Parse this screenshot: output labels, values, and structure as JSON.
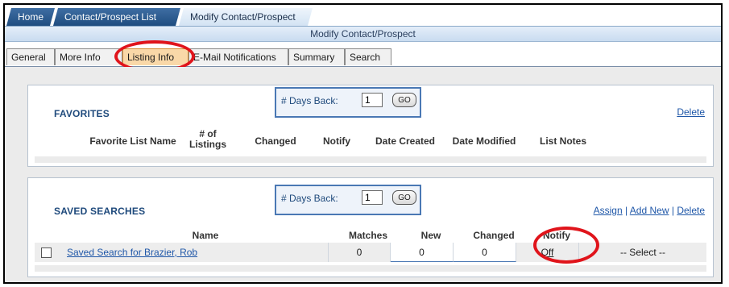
{
  "breadcrumb": {
    "items": [
      {
        "label": "Home"
      },
      {
        "label": "Contact/Prospect List"
      },
      {
        "label": "Modify Contact/Prospect"
      }
    ]
  },
  "subtitle": "Modify Contact/Prospect",
  "tabs": [
    {
      "label": "General"
    },
    {
      "label": "More Info"
    },
    {
      "label": "Listing Info"
    },
    {
      "label": "E-Mail Notifications"
    },
    {
      "label": "Summary"
    },
    {
      "label": "Search"
    }
  ],
  "favorites": {
    "title": "FAVORITES",
    "days_back_label": "# Days Back:",
    "days_back_value": "1",
    "go_label": "GO",
    "delete_label": "Delete",
    "columns": {
      "name": "Favorite List Name",
      "listings_line1": "# of",
      "listings_line2": "Listings",
      "changed": "Changed",
      "notify": "Notify",
      "date_created": "Date Created",
      "date_modified": "Date Modified",
      "list_notes": "List Notes"
    }
  },
  "saved_searches": {
    "title": "SAVED SEARCHES",
    "days_back_label": "# Days Back:",
    "days_back_value": "1",
    "go_label": "GO",
    "assign_label": "Assign",
    "add_new_label": "Add New",
    "delete_label": "Delete",
    "separator": "|",
    "columns": {
      "name": "Name",
      "matches": "Matches",
      "new": "New",
      "changed": "Changed",
      "notify": "Notify"
    },
    "rows": [
      {
        "name": "Saved Search for Brazier, Rob",
        "matches": "0",
        "new": "0",
        "changed": "0",
        "notify": "Off",
        "action": "-- Select --"
      }
    ]
  },
  "colors": {
    "highlight_ring": "#e0141b",
    "section_title": "#1f4a7c",
    "link": "#1f57a8",
    "breadcrumb_bg": "#1f4d80",
    "selected_tab": "#f9d8a8"
  }
}
